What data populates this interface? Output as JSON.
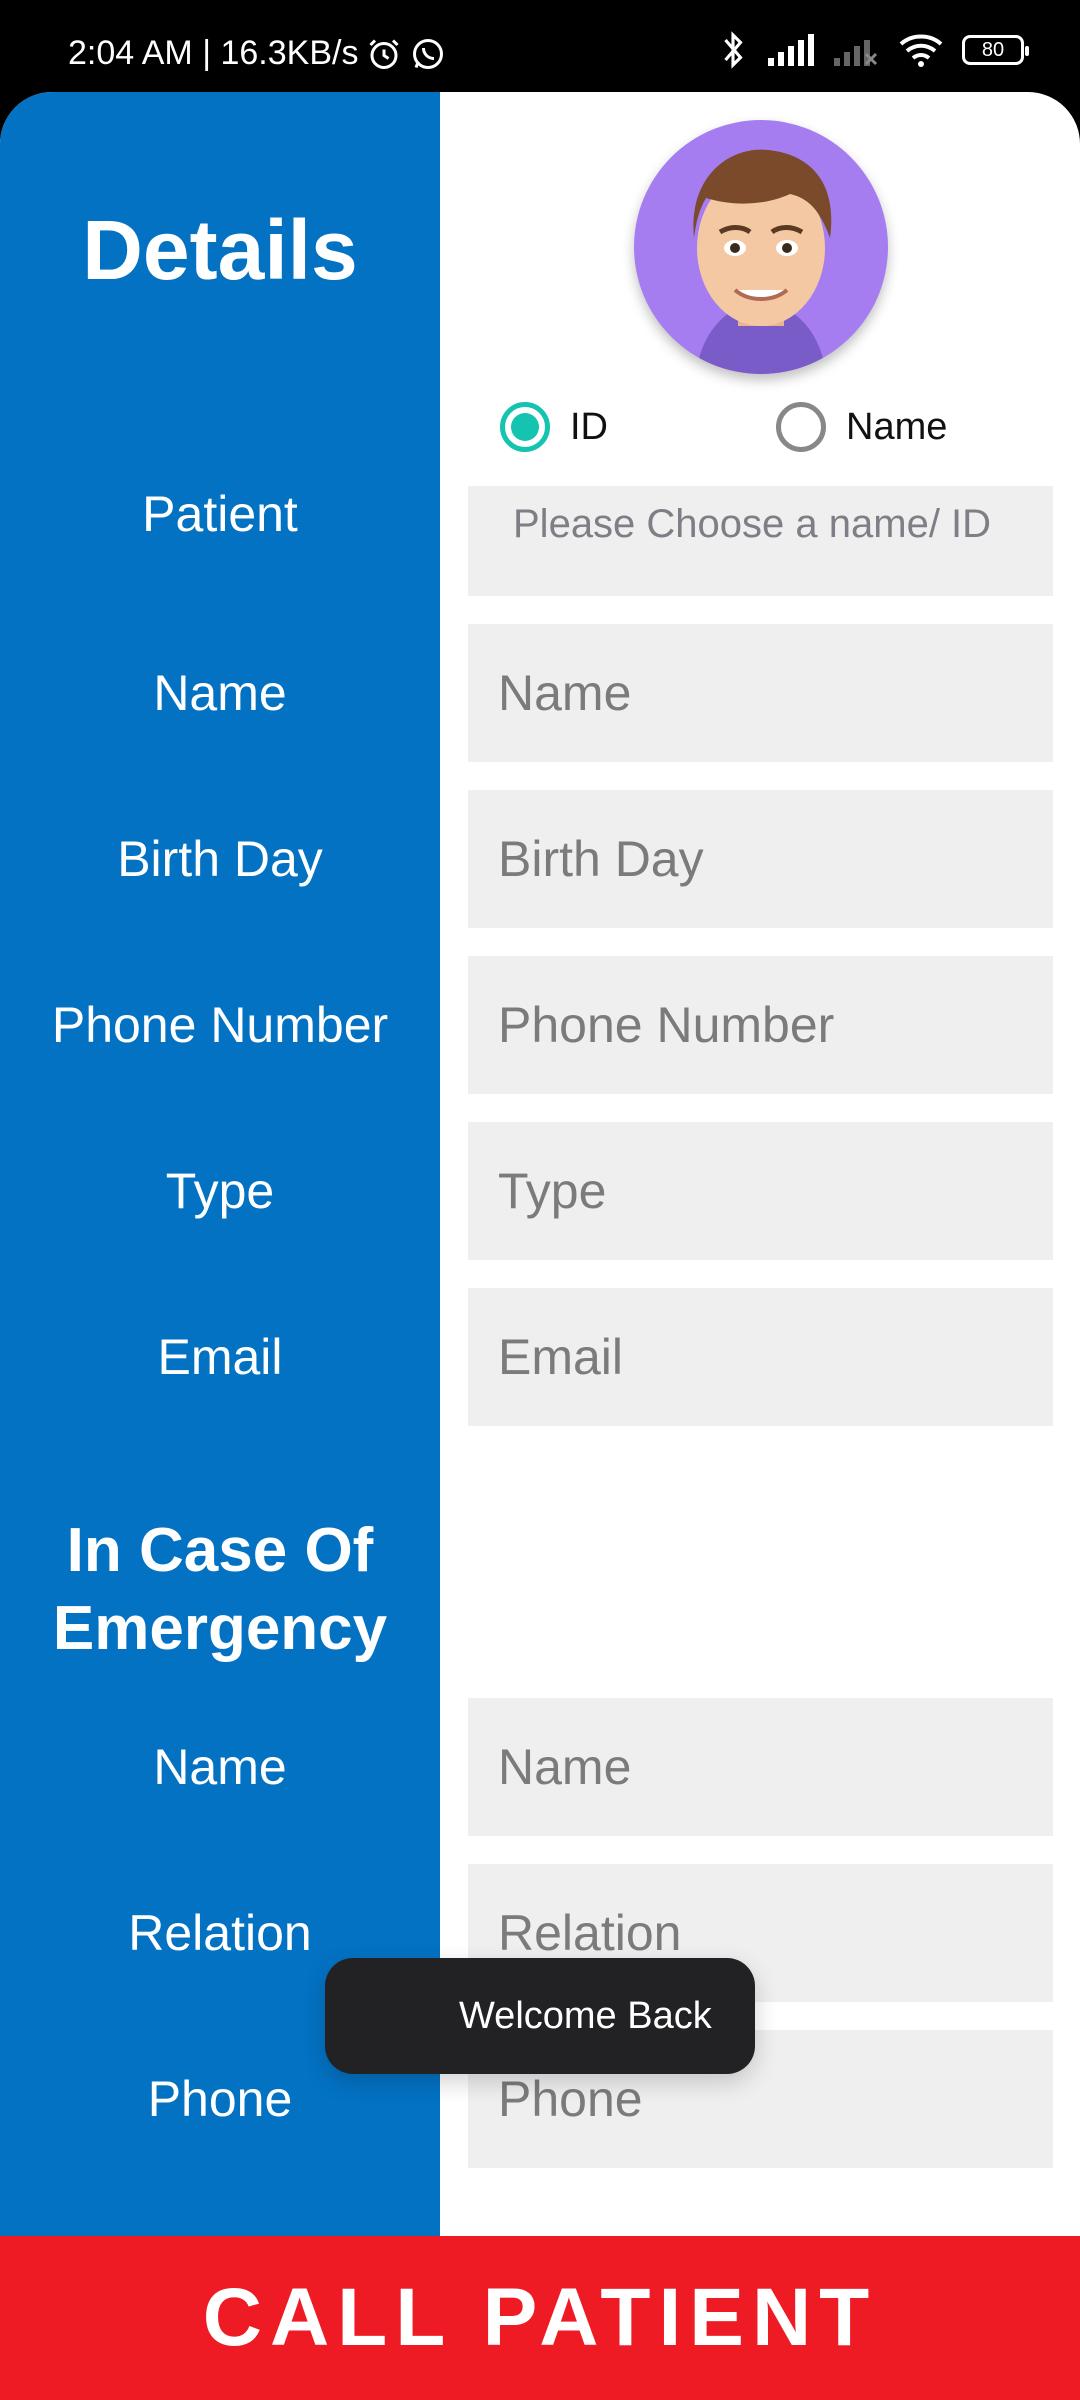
{
  "status_bar": {
    "time_speed": "2:04 AM | 16.3KB/s",
    "battery": "80"
  },
  "details": {
    "title": "Details",
    "avatar_bg_color": "#a67df0",
    "radio": {
      "id_label": "ID",
      "name_label": "Name",
      "selected": "ID"
    },
    "patient": {
      "label": "Patient",
      "placeholder": "Please Choose a name/ ID"
    },
    "fields": [
      {
        "label": "Name",
        "placeholder": "Name"
      },
      {
        "label": "Birth Day",
        "placeholder": "Birth Day"
      },
      {
        "label": "Phone Number",
        "placeholder": "Phone Number"
      },
      {
        "label": "Type",
        "placeholder": "Type"
      },
      {
        "label": "Email",
        "placeholder": "Email"
      }
    ]
  },
  "emergency": {
    "title": "In Case Of Emergency",
    "fields": [
      {
        "label": "Name",
        "placeholder": "Name"
      },
      {
        "label": "Relation",
        "placeholder": "Relation"
      },
      {
        "label": "Phone",
        "placeholder": "Phone"
      }
    ]
  },
  "toast": "Welcome Back",
  "call_button": "CALL PATIENT",
  "colors": {
    "primary": "#0372c3",
    "accent": "#14c4b0",
    "call": "#ef1b24"
  }
}
